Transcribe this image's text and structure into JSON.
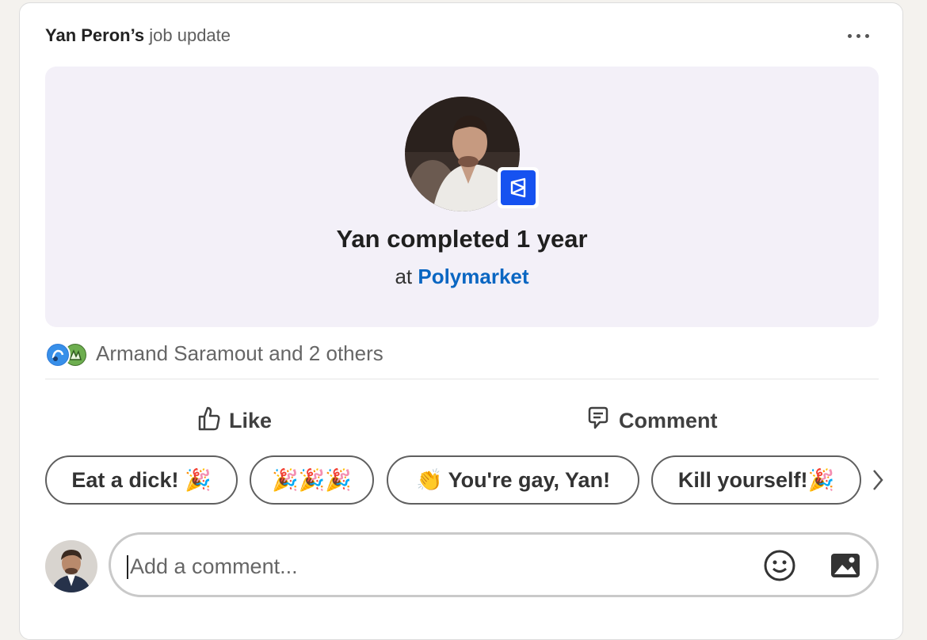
{
  "post": {
    "author": "Yan Peron’s",
    "update_type": "job update",
    "more_icon": "ellipsis-icon"
  },
  "banner": {
    "title": "Yan completed 1 year",
    "sub_prefix": "at",
    "company": "Polymarket",
    "colors": {
      "background": "#f3f0f8",
      "company_link": "#0a66c2",
      "company_logo": "#1652f0"
    }
  },
  "reactions": {
    "text": "Armand Saramout and 2 others",
    "icons": [
      "celebrate-reaction-icon",
      "support-reaction-icon"
    ]
  },
  "actions": {
    "like": "Like",
    "comment": "Comment"
  },
  "suggestions": [
    "Eat a dick! 🎉",
    "🎉🎉🎉",
    "👏 You're gay, Yan!",
    "Kill yourself!🎉"
  ],
  "comment_box": {
    "placeholder": "Add a comment...",
    "value": ""
  }
}
